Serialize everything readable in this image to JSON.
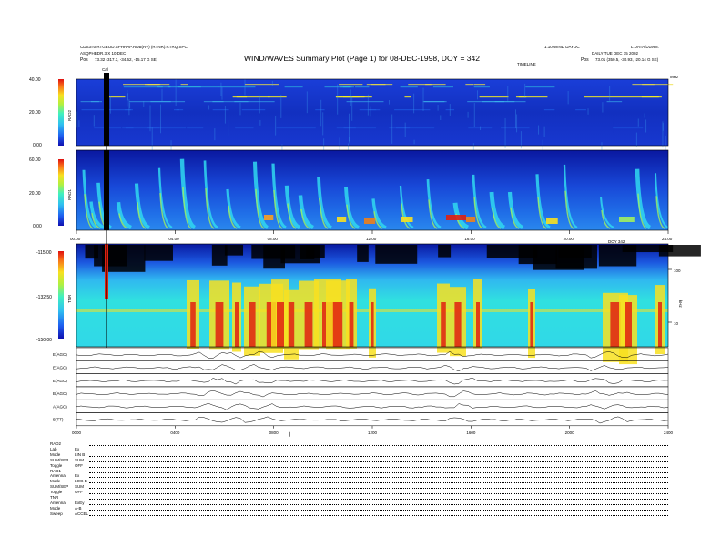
{
  "header": {
    "left_line1": "CDS3=0.RTGEOD.SPHRAP.RDB(RV) (RTNR).RTRQ.SPC",
    "left_line2": "ASQPHBDR.3 X 10 DEC",
    "left_pos_label": "Pos",
    "left_pos_value": "73.32 (317.3, -34.62, -15.17 G SE)",
    "title": "WIND/WAVES Summary Plot (Page 1) for 08-DEC-1998, DOY = 342",
    "right_line0": "1.10 WIND DAYDC",
    "right_line0b": "L.DATA/D1998.",
    "right_line1": "DAILY TUE DEC 15 2002",
    "right_line2": "TIMELINE",
    "right_pos_label": "Pos",
    "right_pos_value": "73.01 (350.5, -30.93, -20.14 G SE)",
    "cal_label": "Cal"
  },
  "panels": {
    "rad2_label": "RAD2",
    "rad2_ticks": [
      "40.00",
      "20.00",
      "0.00"
    ],
    "rad1_label": "RAD1",
    "rad1_ticks": [
      "60.00",
      "20.00",
      "0.00"
    ],
    "tnr_label": "TNR",
    "tnr_ticks": [
      "-115.00",
      "-132.50",
      "-150.00"
    ],
    "tnr_right_ticks": [
      "100",
      "10"
    ],
    "line_labels": [
      "E(AGC)",
      "E(AGC)",
      "E(AGC)",
      "B(AGC)",
      "A(AGC)",
      "B(TT)"
    ],
    "top_right": "MHz",
    "tnr_right_unit": "kHz",
    "top_time_ticks": [
      "00:00",
      "04:00",
      "08:00",
      "12:00",
      "16:00",
      "20:00",
      "24:00"
    ],
    "mid_time_label": "DOY 342",
    "bottom_time_ticks": [
      "0000",
      "0400",
      "0800",
      "1200",
      "1600",
      "2000",
      "2400"
    ]
  },
  "footer": {
    "rows": [
      {
        "k": "RAD2",
        "v": ""
      },
      {
        "k": "Lab",
        "v": "Ex"
      },
      {
        "k": "Mode",
        "v": "LIN B"
      },
      {
        "k": "SUM/SEP",
        "v": "SUM"
      },
      {
        "k": "Toggle",
        "v": "OFF"
      },
      {
        "k": "RAD1",
        "v": ""
      },
      {
        "k": "Antenna",
        "v": "Ex"
      },
      {
        "k": "Mode",
        "v": "LOG B"
      },
      {
        "k": "SUM/SEP",
        "v": "SUM"
      },
      {
        "k": "Toggle",
        "v": "OFF"
      },
      {
        "k": "TNR",
        "v": ""
      },
      {
        "k": "Antenna",
        "v": "ExEy"
      },
      {
        "k": "Mode",
        "v": "A-B"
      },
      {
        "k": "Sweep",
        "v": "ACCEL"
      }
    ]
  },
  "colors": {
    "spectrum": [
      "#000000",
      "#0a14a8",
      "#1e50e8",
      "#3ca0f0",
      "#30e0e0",
      "#a0f060",
      "#f8f020",
      "#f89018",
      "#e02010"
    ]
  },
  "chart_data": [
    {
      "type": "heatmap",
      "title": "WIND/WAVES Summary Plot (Page 1) for 08-DEC-1998, DOY = 342",
      "name": "RAD2",
      "ylabel": "RAD2",
      "colorbar_ticks": [
        40.0,
        20.0,
        0.0
      ],
      "x_ticks": [
        "00:00",
        "04:00",
        "08:00",
        "12:00",
        "16:00",
        "20:00",
        "24:00"
      ]
    },
    {
      "type": "heatmap",
      "name": "RAD1",
      "ylabel": "RAD1",
      "colorbar_ticks": [
        60.0,
        20.0,
        0.0
      ],
      "x_ticks": [
        "00:00",
        "04:00",
        "08:00",
        "12:00",
        "16:00",
        "20:00",
        "24:00"
      ]
    },
    {
      "type": "heatmap",
      "name": "TNR",
      "ylabel": "TNR",
      "colorbar_ticks": [
        -115.0,
        -132.5,
        -150.0
      ],
      "y_right_ticks": [
        100,
        10
      ]
    },
    {
      "type": "line",
      "series": [
        {
          "name": "E(AGC)"
        },
        {
          "name": "E(AGC)"
        },
        {
          "name": "E(AGC)"
        },
        {
          "name": "B(AGC)"
        },
        {
          "name": "A(AGC)"
        },
        {
          "name": "B(TT)"
        }
      ],
      "x_ticks": [
        "0000",
        "0400",
        "0800",
        "1200",
        "1600",
        "2000",
        "2400"
      ]
    }
  ]
}
